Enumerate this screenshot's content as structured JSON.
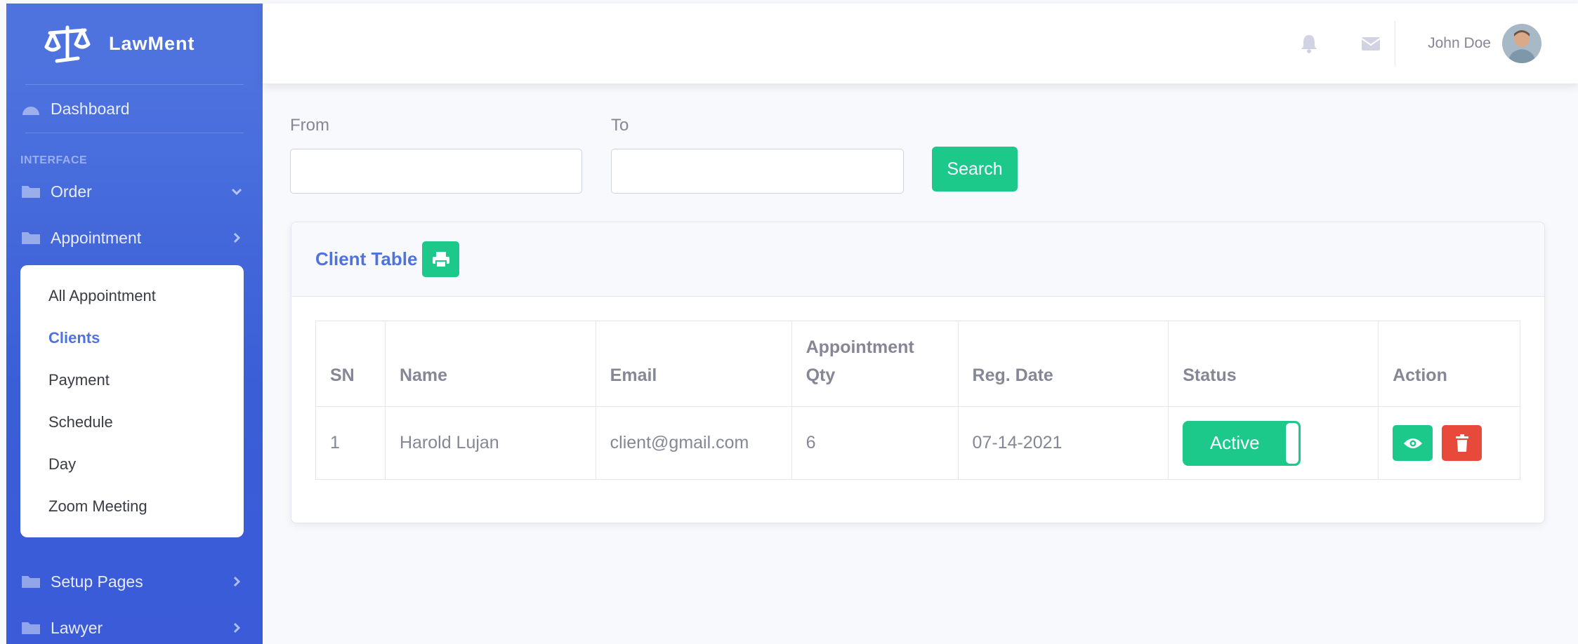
{
  "brand": {
    "name": "LawMent"
  },
  "sidebar": {
    "dashboard_label": "Dashboard",
    "heading": "INTERFACE",
    "items": [
      {
        "label": "Order"
      },
      {
        "label": "Appointment"
      }
    ],
    "submenu": [
      {
        "label": "All Appointment"
      },
      {
        "label": "Clients"
      },
      {
        "label": "Payment"
      },
      {
        "label": "Schedule"
      },
      {
        "label": "Day"
      },
      {
        "label": "Zoom Meeting"
      }
    ],
    "bottom_items": [
      {
        "label": "Setup Pages"
      },
      {
        "label": "Lawyer"
      }
    ]
  },
  "topbar": {
    "user_name": "John Doe"
  },
  "filters": {
    "from_label": "From",
    "to_label": "To",
    "from_value": "",
    "to_value": "",
    "search_label": "Search"
  },
  "card": {
    "title": "Client Table",
    "columns": [
      "SN",
      "Name",
      "Email",
      "Appointment Qty",
      "Reg. Date",
      "Status",
      "Action"
    ],
    "rows": [
      {
        "sn": "1",
        "name": "Harold Lujan",
        "email": "client@gmail.com",
        "qty": "6",
        "reg_date": "07-14-2021",
        "status": "Active"
      }
    ]
  },
  "colors": {
    "primary": "#4e73df",
    "success": "#1cc88a",
    "danger": "#e74a3b",
    "text_muted": "#858796"
  }
}
